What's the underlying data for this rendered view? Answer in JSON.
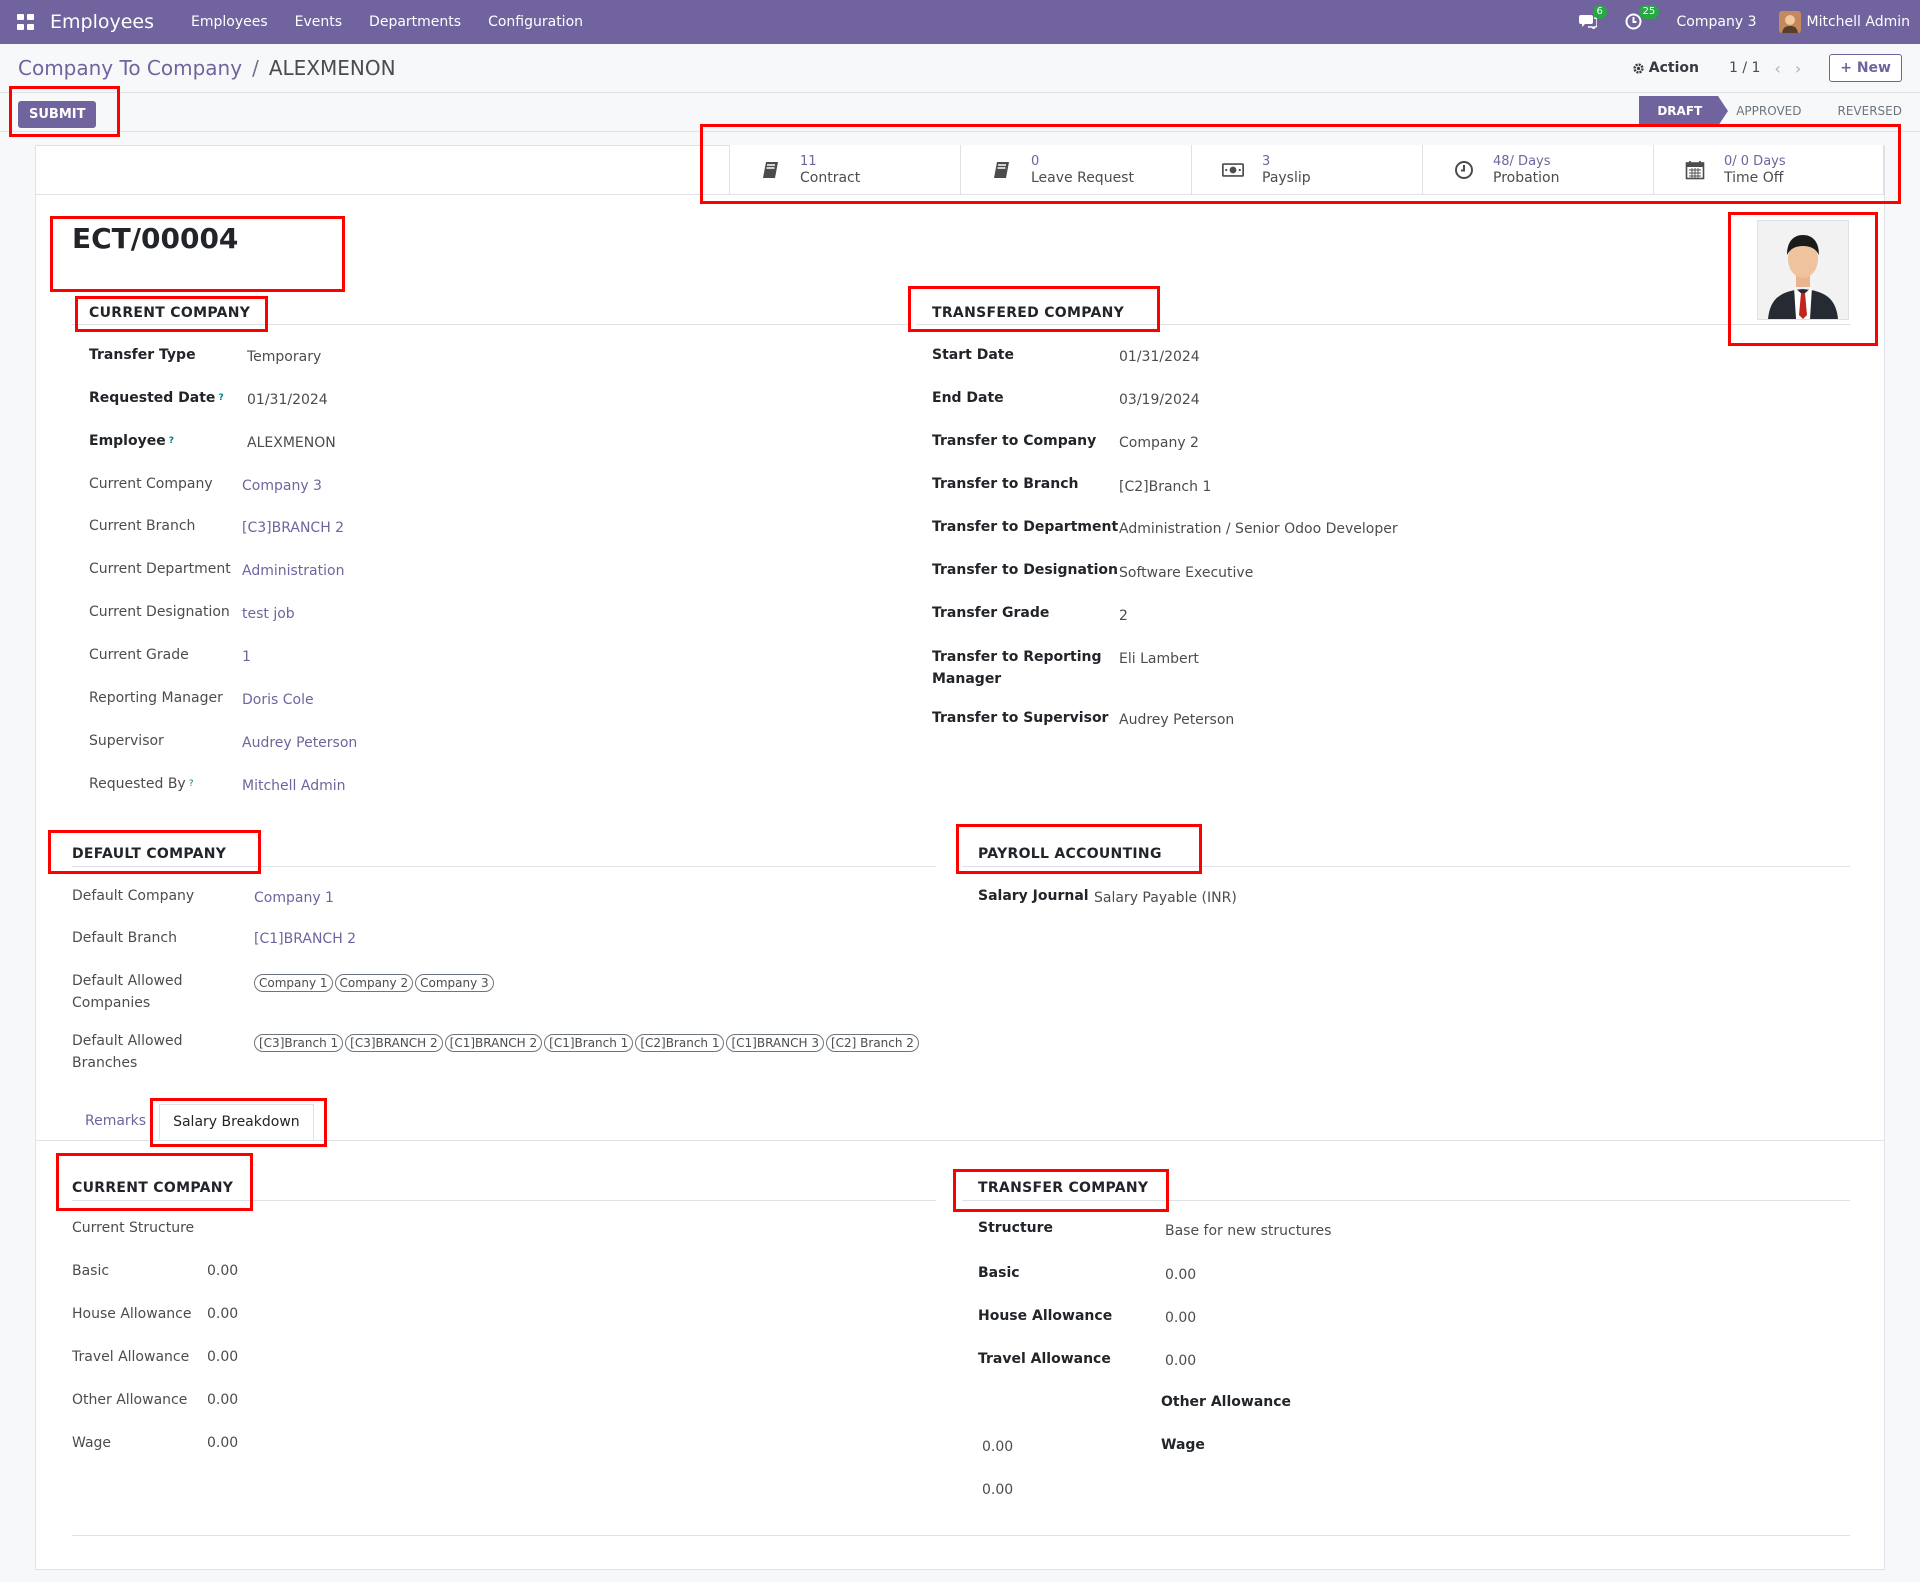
{
  "navbar": {
    "app_title": "Employees",
    "menus": [
      "Employees",
      "Events",
      "Departments",
      "Configuration"
    ],
    "messages_count": "6",
    "activities_count": "25",
    "company": "Company 3",
    "user": "Mitchell Admin"
  },
  "control_panel": {
    "breadcrumb_parent": "Company To Company",
    "breadcrumb_sep": "/",
    "breadcrumb_current": "ALEXMENON",
    "action_label": "Action",
    "pager": "1 / 1",
    "new_label": "New"
  },
  "statusbar": {
    "submit_label": "SUBMIT",
    "steps": [
      "DRAFT",
      "APPROVED",
      "REVERSED"
    ],
    "active_step": "DRAFT"
  },
  "smart_buttons": [
    {
      "value": "11",
      "label": "Contract",
      "icon": "book-icon"
    },
    {
      "value": "0",
      "label": "Leave Request",
      "icon": "book-icon"
    },
    {
      "value": "3",
      "label": "Payslip",
      "icon": "money-icon"
    },
    {
      "value": "48/ Days",
      "label": "Probation",
      "icon": "clock-icon"
    },
    {
      "value": "0/ 0 Days",
      "label": "Time Off",
      "icon": "calendar-icon"
    }
  ],
  "record": {
    "name": "ECT/00004"
  },
  "current_company": {
    "title": "CURRENT COMPANY",
    "fields": [
      {
        "label": "Transfer Type",
        "value": "Temporary"
      },
      {
        "label": "Requested Date",
        "value": "01/31/2024"
      },
      {
        "label": "Employee",
        "value": "ALEXMENON"
      },
      {
        "label": "Current Company",
        "value": "Company 3"
      },
      {
        "label": "Current Branch",
        "value": "[C3]BRANCH 2"
      },
      {
        "label": "Current Department",
        "value": "Administration"
      },
      {
        "label": "Current Designation",
        "value": "test job"
      },
      {
        "label": "Current Grade",
        "value": "1"
      },
      {
        "label": "Reporting Manager",
        "value": "Doris Cole"
      },
      {
        "label": "Supervisor",
        "value": "Audrey Peterson"
      },
      {
        "label": "Requested By",
        "value": "Mitchell Admin"
      }
    ]
  },
  "transfered_company": {
    "title": "TRANSFERED COMPANY",
    "fields": [
      {
        "label": "Start Date",
        "value": "01/31/2024"
      },
      {
        "label": "End Date",
        "value": "03/19/2024"
      },
      {
        "label": "Transfer to Company",
        "value": "Company 2"
      },
      {
        "label": "Transfer to Branch",
        "value": "[C2]Branch 1"
      },
      {
        "label": "Transfer to Department",
        "value": "Administration / Senior Odoo Developer"
      },
      {
        "label": "Transfer to Designation",
        "value": "Software Executive"
      },
      {
        "label": "Transfer Grade",
        "value": "2"
      },
      {
        "label": "Transfer to Reporting",
        "label2": "Manager",
        "value": "Eli Lambert"
      },
      {
        "label": "Transfer to Supervisor",
        "value": "Audrey Peterson"
      }
    ]
  },
  "default_company": {
    "title": "DEFAULT COMPANY",
    "default_company_label": "Default Company",
    "default_company_value": "Company 1",
    "default_branch_label": "Default Branch",
    "default_branch_value": "[C1]BRANCH 2",
    "allowed_companies_label_1": "Default Allowed",
    "allowed_companies_label_2": "Companies",
    "allowed_companies": [
      "Company 1",
      "Company 2",
      "Company 3"
    ],
    "allowed_branches_label_1": "Default Allowed",
    "allowed_branches_label_2": "Branches",
    "allowed_branches": [
      "[C3]Branch 1",
      "[C3]BRANCH 2",
      "[C1]BRANCH 2",
      "[C1]Branch 1",
      "[C2]Branch 1",
      "[C1]BRANCH 3",
      "[C2] Branch 2"
    ]
  },
  "payroll_accounting": {
    "title": "PAYROLL ACCOUNTING",
    "salary_journal_label": "Salary Journal",
    "salary_journal_value": "Salary Payable (INR)"
  },
  "tabs": [
    "Remarks",
    "Salary Breakdown"
  ],
  "active_tab": "Salary Breakdown",
  "salary_current": {
    "title": "CURRENT COMPANY",
    "structure_label": "Current Structure",
    "rows": [
      {
        "label": "Basic",
        "value": "0.00"
      },
      {
        "label": "House Allowance",
        "value": "0.00"
      },
      {
        "label": "Travel Allowance",
        "value": "0.00"
      },
      {
        "label": "Other Allowance",
        "value": "0.00"
      },
      {
        "label": "Wage",
        "value": "0.00"
      }
    ]
  },
  "salary_transfer": {
    "title": "TRANSFER COMPANY",
    "structure_label": "Structure",
    "structure_value": "Base for new structures",
    "rows": [
      {
        "label": "Basic",
        "value": "0.00"
      },
      {
        "label": "House Allowance",
        "value": "0.00"
      },
      {
        "label": "Travel Allowance",
        "value": "0.00"
      },
      {
        "label": "Other Allowance",
        "value": "0.00"
      },
      {
        "label": "Wage",
        "value": "0.00"
      }
    ]
  }
}
